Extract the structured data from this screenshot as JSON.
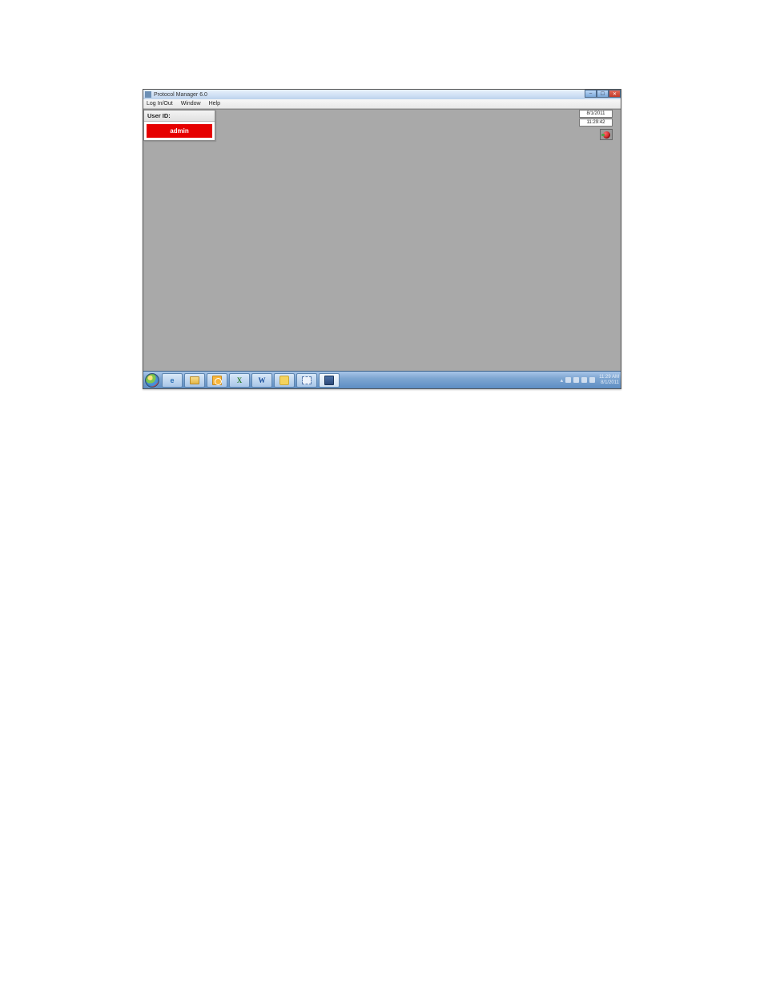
{
  "window": {
    "title": "Protocol Manager 6.0"
  },
  "menu": {
    "items": [
      "Log In/Out",
      "Window",
      "Help"
    ]
  },
  "user_panel": {
    "label": "User ID:",
    "value": "admin"
  },
  "status": {
    "date": "8/1/2011",
    "time": "11:29:42"
  },
  "taskbar": {
    "clock_time": "11:29 AM",
    "clock_date": "8/1/2011"
  }
}
